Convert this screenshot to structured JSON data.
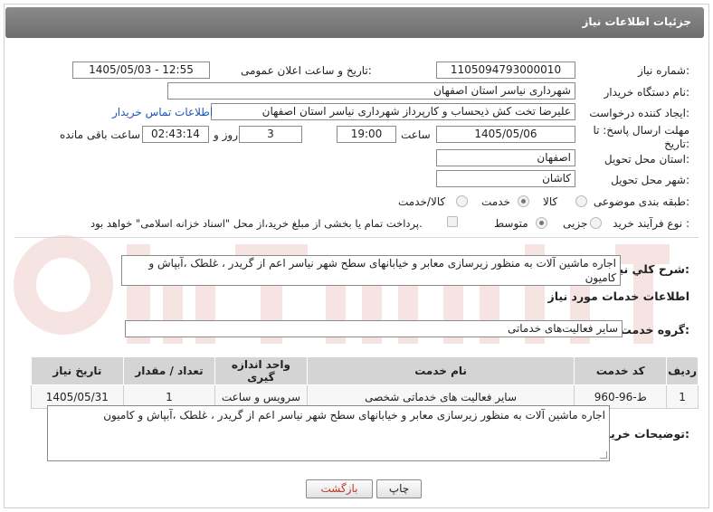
{
  "header": {
    "title": "جزئیات اطلاعات نیاز"
  },
  "fields": {
    "need_number_label": "شماره نیاز:",
    "need_number": "1105094793000010",
    "announce_label": "تاریخ و ساعت اعلان عمومی:",
    "announce_value": "1405/05/03 - 12:55",
    "buyer_org_label": "نام دستگاه خریدار:",
    "buyer_org": "شهرداری نیاسر استان اصفهان",
    "creator_label": "ایجاد کننده درخواست:",
    "creator": "علیرضا  تخت کش ذیحساب و کارپرداز شهرداری نیاسر استان اصفهان",
    "buyer_contact_link": "اطلاعات تماس خریدار",
    "deadline_label": "مهلت ارسال پاسخ: تا تاریخ:",
    "deadline_date": "1405/05/06",
    "time_label": "ساعت",
    "deadline_time": "19:00",
    "days_count": "3",
    "days_label": "روز و",
    "remaining_time": "02:43:14",
    "remaining_label": "ساعت باقی مانده",
    "province_label": "استان محل تحویل:",
    "province": "اصفهان",
    "city_label": "شهر محل تحویل:",
    "city": "کاشان",
    "category_label": "طبقه بندی موضوعی:",
    "category_options": [
      "کالا",
      "خدمت",
      "کالا/خدمت"
    ],
    "category_selected": "خدمت",
    "process_label": "نوع فرآیند خرید :",
    "process_options": [
      "جزیی",
      "متوسط"
    ],
    "process_selected": "متوسط",
    "payment_note": "پرداخت تمام یا بخشی از مبلغ خرید،از محل \"اسناد خزانه اسلامی\" خواهد بود."
  },
  "description": {
    "label": "شرح کلي نياز:",
    "text": "اجاره ماشین آلات به منظور زیرسازی معابر و خیابانهای سطح شهر نیاسر اعم از گریدر ، غلطک ،آبپاش و کامیون"
  },
  "services": {
    "section_title": "اطلاعات خدمات مورد نیاز",
    "group_label": "گروه خدمت:",
    "group_value": "سایر فعالیت‌های خدماتی",
    "columns": [
      "ردیف",
      "کد خدمت",
      "نام خدمت",
      "واحد اندازه گیری",
      "تعداد / مقدار",
      "تاریخ نیاز"
    ],
    "rows": [
      [
        "1",
        "ط-96-960",
        "سایر فعالیت های خدماتی شخصی",
        "سرویس و ساعت",
        "1",
        "1405/05/31"
      ]
    ]
  },
  "buyer_notes": {
    "label": "توضیحات خریدار:",
    "text": "اجاره ماشین آلات به منظور زیرسازی معابر و خیابانهای سطح شهر نیاسر اعم از گریدر ، غلطک ،آبپاش و کامیون"
  },
  "buttons": {
    "print": "چاپ",
    "back": "بازگشت"
  },
  "colors": {
    "titlebar": "#7a7a7a",
    "link": "#1f56b5",
    "back_button_text": "#c0392b",
    "watermark": "#c0392b"
  }
}
